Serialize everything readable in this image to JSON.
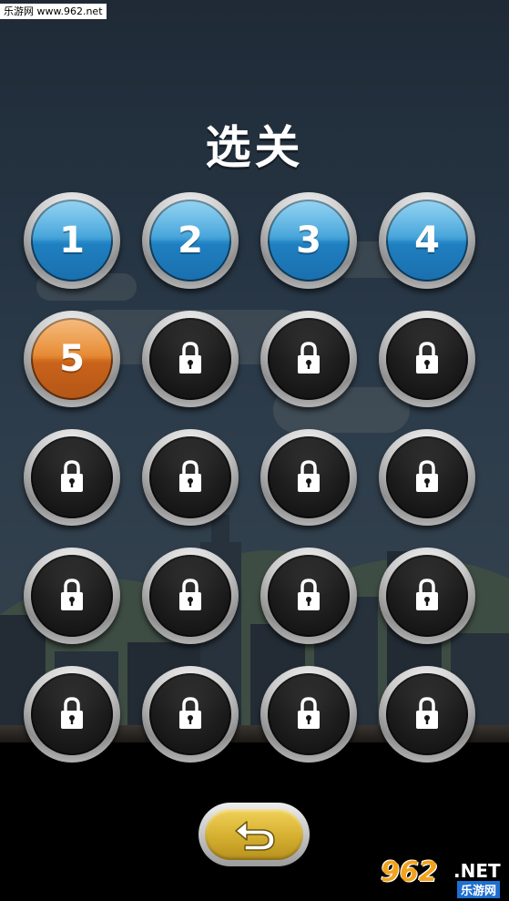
{
  "watermark_top": "乐游网 www.962.net",
  "title": "选关",
  "levels": [
    {
      "label": "1",
      "state": "unlocked"
    },
    {
      "label": "2",
      "state": "unlocked"
    },
    {
      "label": "3",
      "state": "unlocked"
    },
    {
      "label": "4",
      "state": "unlocked"
    },
    {
      "label": "5",
      "state": "current"
    },
    {
      "label": "",
      "state": "locked"
    },
    {
      "label": "",
      "state": "locked"
    },
    {
      "label": "",
      "state": "locked"
    },
    {
      "label": "",
      "state": "locked"
    },
    {
      "label": "",
      "state": "locked"
    },
    {
      "label": "",
      "state": "locked"
    },
    {
      "label": "",
      "state": "locked"
    },
    {
      "label": "",
      "state": "locked"
    },
    {
      "label": "",
      "state": "locked"
    },
    {
      "label": "",
      "state": "locked"
    },
    {
      "label": "",
      "state": "locked"
    },
    {
      "label": "",
      "state": "locked"
    },
    {
      "label": "",
      "state": "locked"
    },
    {
      "label": "",
      "state": "locked"
    },
    {
      "label": "",
      "state": "locked"
    }
  ],
  "back_button_icon": "return-arrow-icon",
  "watermark_logo": {
    "big": "962",
    "net": ".NET",
    "sub": "乐游网"
  },
  "colors": {
    "unlocked": "#3a9fd8",
    "current": "#e58326",
    "locked": "#161616",
    "back_button": "#d8b232"
  }
}
